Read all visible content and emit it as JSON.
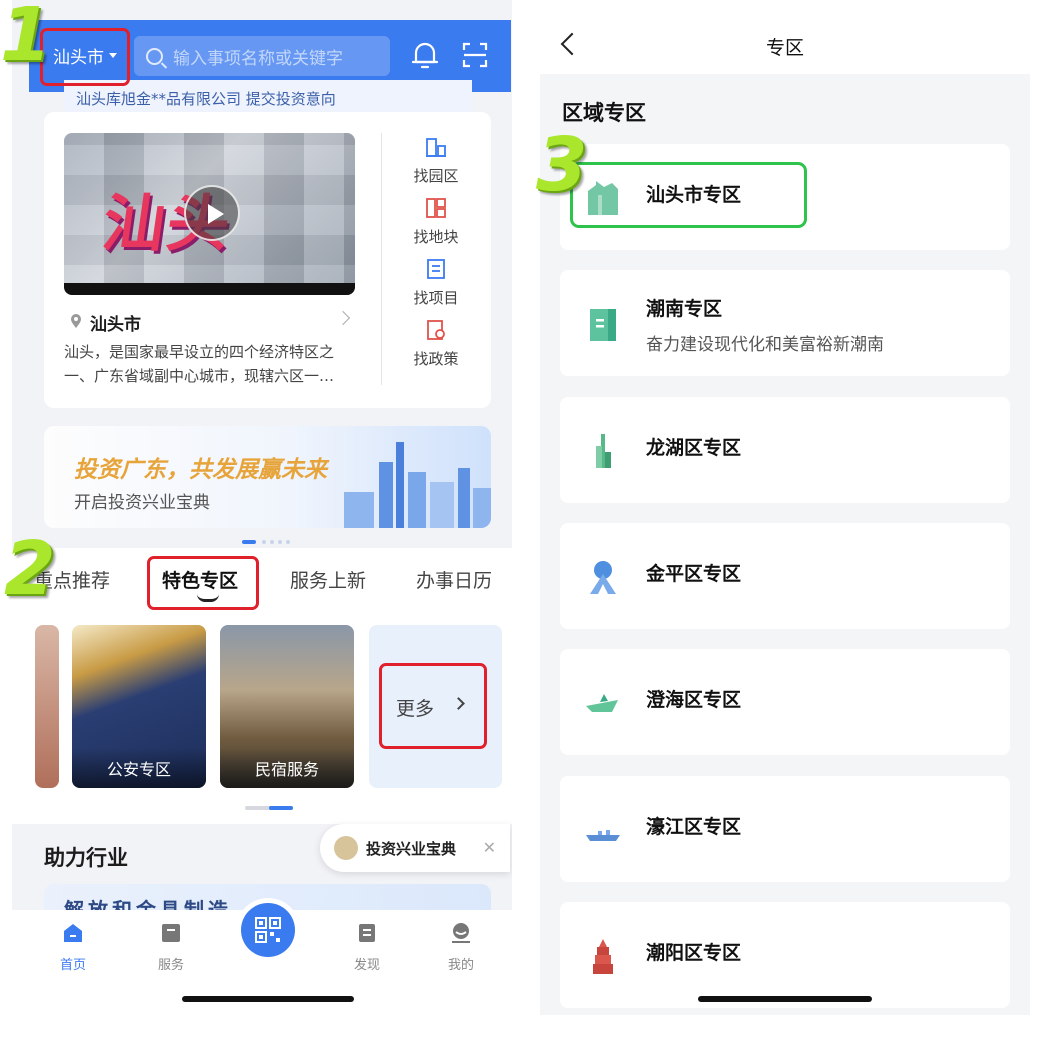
{
  "left": {
    "header": {
      "city": "汕头市",
      "search_placeholder": "输入事项名称或关键字"
    },
    "notice": "汕头库旭金**品有限公司 提交投资意向",
    "city_card": {
      "video_title": "汕头",
      "city_name": "汕头市",
      "desc": "汕头，是国家最早设立的四个经济特区之一、广东省域副中心城市，现辖六区一…",
      "quick": [
        {
          "label": "找园区",
          "icon": "park-icon"
        },
        {
          "label": "找地块",
          "icon": "land-icon"
        },
        {
          "label": "找项目",
          "icon": "project-icon"
        },
        {
          "label": "找政策",
          "icon": "policy-icon"
        }
      ]
    },
    "banner": {
      "title": "投资广东，共发展赢未来",
      "subtitle": "开启投资兴业宝典"
    },
    "tabs": [
      "重点推荐",
      "特色专区",
      "服务上新",
      "办事日历"
    ],
    "thumbs": [
      "公安专区",
      "民宿服务"
    ],
    "more": "更多",
    "industry_title": "助力行业",
    "float_pill": "投资兴业宝典",
    "peek_text": "解放和金具制造",
    "tabbar": [
      "首页",
      "服务",
      "发现",
      "我的"
    ],
    "steps": [
      "1",
      "2"
    ]
  },
  "right": {
    "title": "专区",
    "section": "区域专区",
    "step": "3",
    "zones": [
      {
        "name": "汕头市专区",
        "sub": "",
        "icon": "building-icon",
        "color": "#74c7a4"
      },
      {
        "name": "潮南专区",
        "sub": "奋力建设现代化和美富裕新潮南",
        "icon": "document-building-icon",
        "color": "#5cc39e"
      },
      {
        "name": "龙湖区专区",
        "sub": "",
        "icon": "tower-icon",
        "color": "#57b98a"
      },
      {
        "name": "金平区专区",
        "sub": "",
        "icon": "monument-icon",
        "color": "#4f8fe0"
      },
      {
        "name": "澄海区专区",
        "sub": "",
        "icon": "boat-icon",
        "color": "#62c59a"
      },
      {
        "name": "濠江区专区",
        "sub": "",
        "icon": "bridge-icon",
        "color": "#5a8fd6"
      },
      {
        "name": "潮阳区专区",
        "sub": "",
        "icon": "pagoda-icon",
        "color": "#d9574c"
      }
    ]
  },
  "colors": {
    "accent": "#3b7bf0",
    "red_box": "#e0202a",
    "green_box": "#2ec34a",
    "step_green": "#a9e62c"
  }
}
